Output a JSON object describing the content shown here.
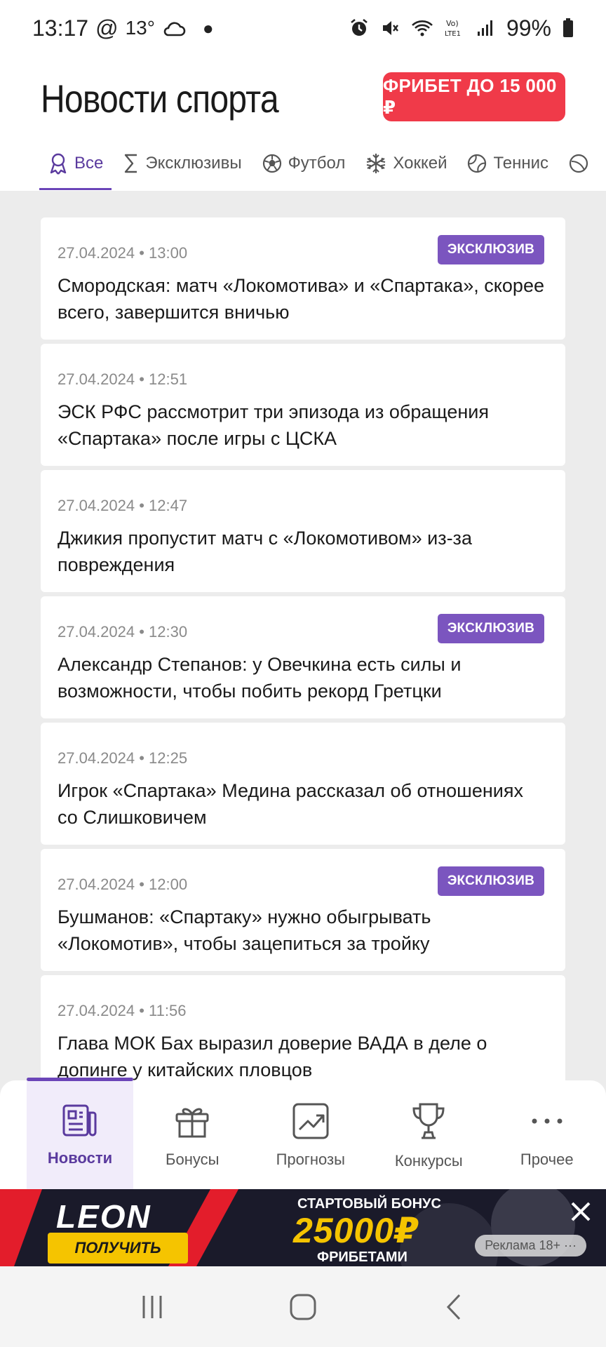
{
  "status_bar": {
    "time": "13:17",
    "temperature": "13°",
    "battery": "99%"
  },
  "header": {
    "title": "Новости спорта",
    "freebet_label": "ФРИБЕТ ДО 15 000 ₽"
  },
  "tabs": [
    {
      "label": "Все",
      "icon": "award-icon",
      "active": true
    },
    {
      "label": "Эксклюзивы",
      "icon": "sigma-icon",
      "active": false
    },
    {
      "label": "Футбол",
      "icon": "soccer-ball-icon",
      "active": false
    },
    {
      "label": "Хоккей",
      "icon": "snowflake-icon",
      "active": false
    },
    {
      "label": "Теннис",
      "icon": "tennis-ball-icon",
      "active": false
    }
  ],
  "news": [
    {
      "date": "27.04.2024 • 13:00",
      "headline": "Смородская: матч «Локомотива» и «Спартака», скорее всего, завершится вничью",
      "badge": "ЭКСКЛЮЗИВ"
    },
    {
      "date": "27.04.2024 • 12:51",
      "headline": "ЭСК РФС рассмотрит три эпизода из обращения «Спартака» после игры с ЦСКА",
      "badge": ""
    },
    {
      "date": "27.04.2024 • 12:47",
      "headline": "Джикия пропустит матч с «Локомотивом» из-за повреждения",
      "badge": ""
    },
    {
      "date": "27.04.2024 • 12:30",
      "headline": "Александр Степанов: у Овечкина есть силы и возможности, чтобы побить рекорд Гретцки",
      "badge": "ЭКСКЛЮЗИВ"
    },
    {
      "date": "27.04.2024 • 12:25",
      "headline": "Игрок «Спартака» Медина рассказал об отношениях со Слишковичем",
      "badge": ""
    },
    {
      "date": "27.04.2024 • 12:00",
      "headline": "Бушманов: «Спартаку» нужно обыгрывать «Локомотив», чтобы зацепиться за тройку",
      "badge": "ЭКСКЛЮЗИВ"
    },
    {
      "date": "27.04.2024 • 11:56",
      "headline": "Глава МОК Бах выразил доверие ВАДА в деле о допинге у китайских пловцов",
      "badge": ""
    }
  ],
  "bottom_nav": [
    {
      "label": "Новости",
      "icon": "news-icon",
      "active": true
    },
    {
      "label": "Бонусы",
      "icon": "gift-icon",
      "active": false
    },
    {
      "label": "Прогнозы",
      "icon": "chart-icon",
      "active": false
    },
    {
      "label": "Конкурсы",
      "icon": "trophy-icon",
      "active": false
    },
    {
      "label": "Прочее",
      "icon": "more-icon",
      "active": false
    }
  ],
  "ad": {
    "brand": "LEON",
    "cta": "ПОЛУЧИТЬ",
    "promo_top": "СТАРТОВЫЙ БОНУС",
    "promo_amount": "25000₽",
    "promo_bottom": "ФРИБЕТАМИ",
    "label": "Реклама 18+"
  },
  "colors": {
    "accent": "#6b45b8",
    "badge": "#7b55bf",
    "freebet": "#f03a49",
    "ad_yellow": "#f5c400"
  }
}
